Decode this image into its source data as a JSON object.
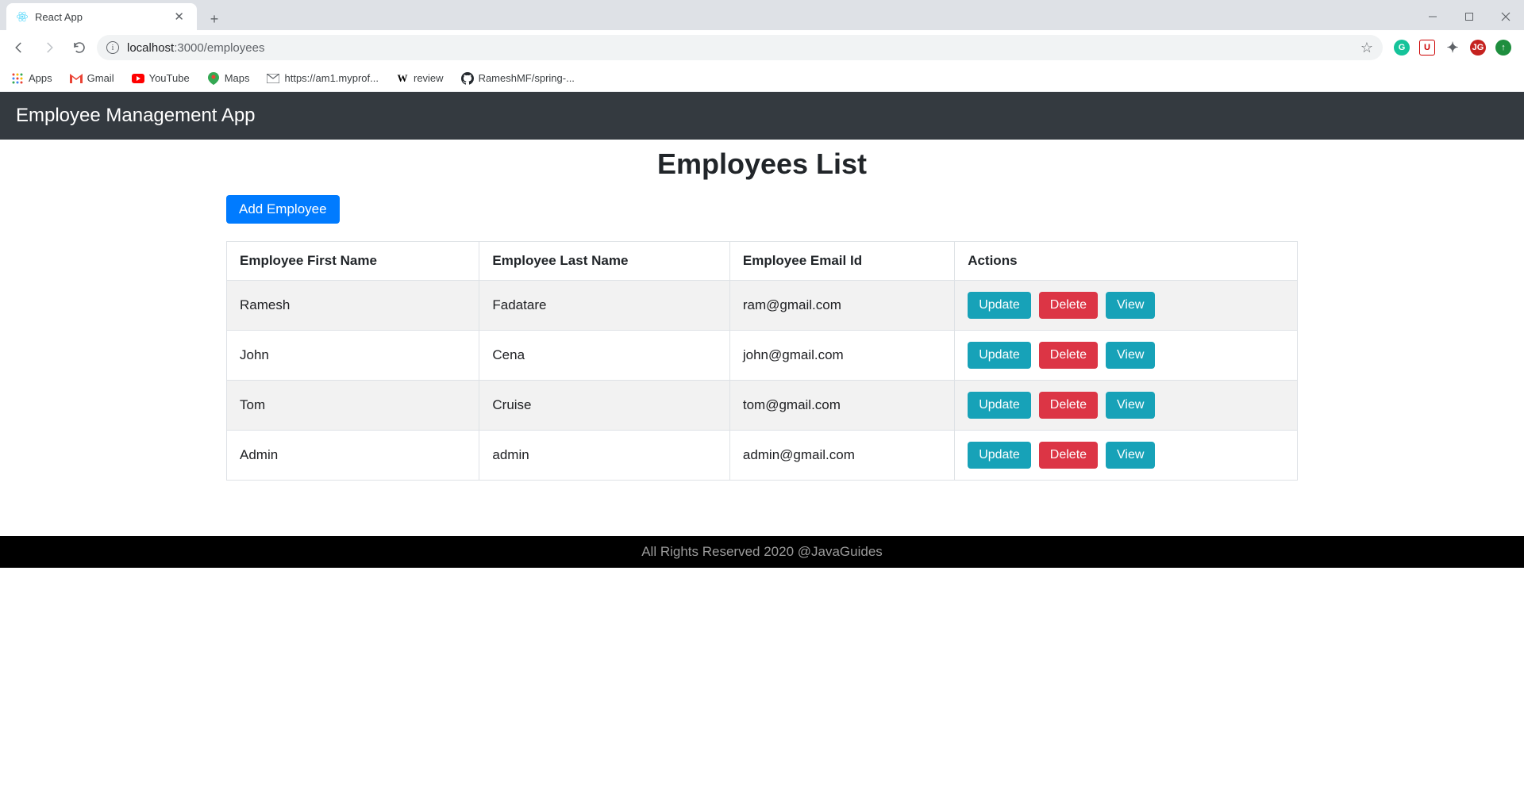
{
  "browser": {
    "tab_title": "React App",
    "url_host": "localhost",
    "url_port_path": ":3000/employees",
    "bookmarks": [
      {
        "label": "Apps"
      },
      {
        "label": "Gmail"
      },
      {
        "label": "YouTube"
      },
      {
        "label": "Maps"
      },
      {
        "label": "https://am1.myprof..."
      },
      {
        "label": "review"
      },
      {
        "label": "RameshMF/spring-..."
      }
    ]
  },
  "app": {
    "navbar_brand": "Employee Management App",
    "page_title": "Employees List",
    "add_button": "Add Employee",
    "table": {
      "headers": [
        "Employee First Name",
        "Employee Last Name",
        "Employee Email Id",
        "Actions"
      ],
      "rows": [
        {
          "first": "Ramesh",
          "last": "Fadatare",
          "email": "ram@gmail.com"
        },
        {
          "first": "John",
          "last": "Cena",
          "email": "john@gmail.com"
        },
        {
          "first": "Tom",
          "last": "Cruise",
          "email": "tom@gmail.com"
        },
        {
          "first": "Admin",
          "last": "admin",
          "email": "admin@gmail.com"
        }
      ],
      "action_labels": {
        "update": "Update",
        "delete": "Delete",
        "view": "View"
      }
    },
    "footer": "All Rights Reserved 2020 @JavaGuides"
  }
}
